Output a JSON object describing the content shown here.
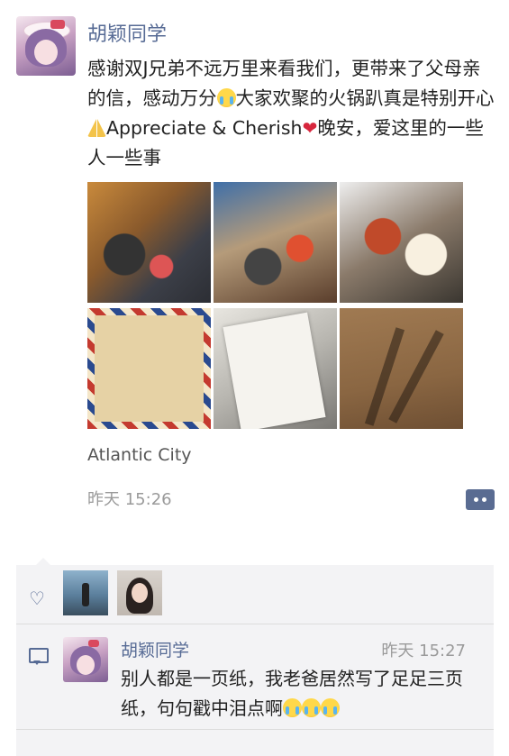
{
  "post": {
    "author": "胡颖同学",
    "text_1": "感谢双J兄弟不远万里来看我们，更带来了父母亲的信，感动万分",
    "text_2": "大家欢聚的火锅趴真是特别开心",
    "text_3": "Appreciate & Cherish",
    "text_4": "晚安，爱这里的一些人一些事",
    "location": "Atlantic City",
    "time": "昨天 15:26",
    "photo_count": 6
  },
  "likes": {
    "icon": "heart-icon",
    "users": [
      "liker-1",
      "liker-2"
    ]
  },
  "comments": [
    {
      "author": "胡颖同学",
      "time": "昨天 15:27",
      "text": "别人都是一页纸，我老爸居然写了足足三页纸，句句戳中泪点啊"
    }
  ],
  "icons": {
    "crying_emoji": "loudly-crying-face",
    "pray_emoji": "folded-hands",
    "heart_emoji": "red-heart",
    "more": "more-dots-icon",
    "comment": "comment-bubble-icon"
  },
  "colors": {
    "link_blue": "#576b95",
    "time_gray": "#9a9a9a",
    "comment_bg": "#f3f3f5"
  }
}
